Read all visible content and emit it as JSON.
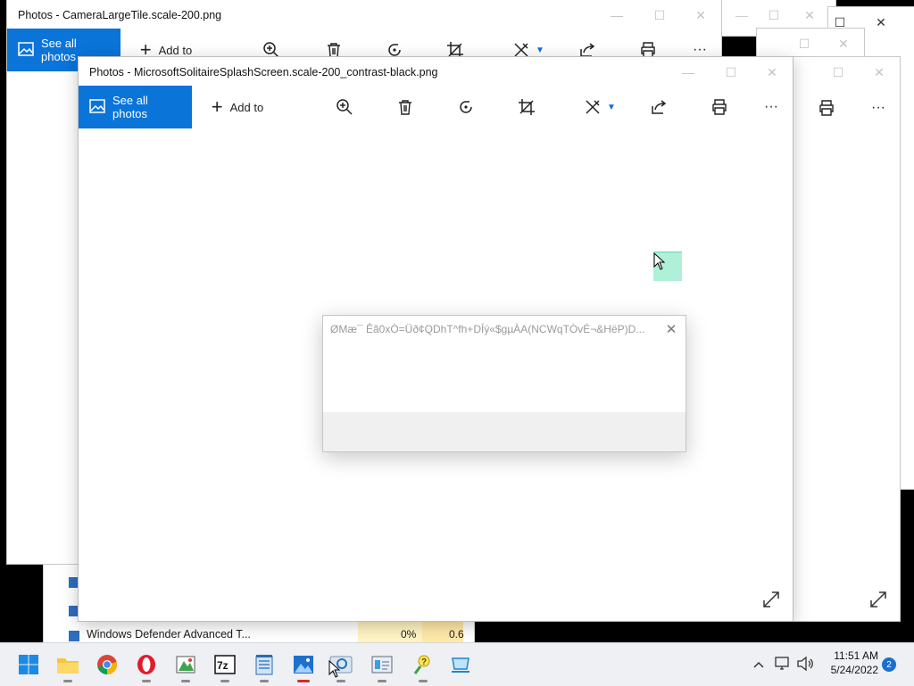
{
  "background_window": {
    "title": "Photos - CameraLargeTile.scale-200.png",
    "see_all_photos": "See all photos",
    "add_to": "Add to"
  },
  "main_window": {
    "title": "Photos - MicrosoftSolitaireSplashScreen.scale-200_contrast-black.png",
    "see_all_photos": "See all photos",
    "add_to": "Add to",
    "more": "···"
  },
  "dialog": {
    "title": "ØMæ¯ Êã0xÒ=Üð¢QDhT^fh+DÍý«$gµÀA(NCWqTÒvÉ¬&HëP)D..."
  },
  "task_manager_behind": {
    "row_name": "Windows Defender Advanced T...",
    "cpu": "0%",
    "memory": "0.6"
  },
  "taskbar": {
    "apps": [
      "start-icon",
      "file-explorer-icon",
      "chrome-icon",
      "opera-icon",
      "paint-icon",
      "7zip-icon",
      "notepad-icon",
      "photos-icon",
      "search-app-icon",
      "task-manager-icon",
      "help-icon",
      "remote-desktop-icon"
    ],
    "clock_time": "11:51 AM",
    "clock_date": "5/24/2022",
    "notification_count": "2"
  },
  "colors": {
    "accent": "#0a74d9",
    "taskbar": "#eef0f3",
    "dialog_footer": "#f0f0f0"
  }
}
